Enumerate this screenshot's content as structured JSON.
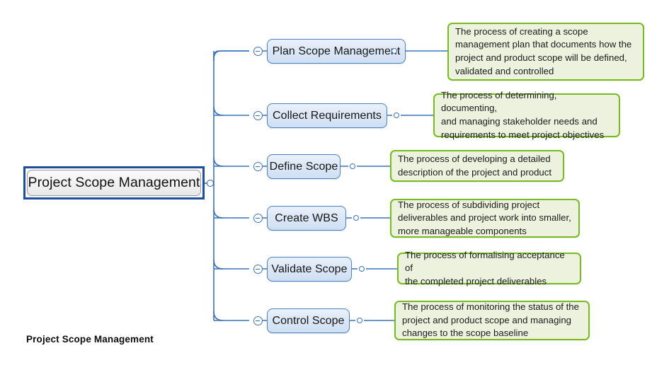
{
  "diagram": {
    "title": "Project Scope Management",
    "caption": "Project Scope Management",
    "colors": {
      "root_border": "#1F4E9C",
      "branch_border": "#4A82C4",
      "branch_fill": "#DBE7F6",
      "desc_border": "#76BC21",
      "desc_fill": "#EDF2DF",
      "connector": "#3C72B9",
      "background": "#FFFFFF"
    },
    "root": {
      "label": "Project Scope Management"
    },
    "branches": [
      {
        "label": "Plan Scope Management",
        "toggle_icon": "minus-circle-icon",
        "description": "The process of creating a scope\nmanagement plan that documents how the\nproject and product scope will be defined,\nvalidated and controlled"
      },
      {
        "label": "Collect Requirements",
        "toggle_icon": "minus-circle-icon",
        "description": "The process of determining, documenting,\nand managing stakeholder needs and\nrequirements to meet project objectives"
      },
      {
        "label": "Define Scope",
        "toggle_icon": "minus-circle-icon",
        "description": "The process of developing a detailed\ndescription of the project and product"
      },
      {
        "label": "Create WBS",
        "toggle_icon": "minus-circle-icon",
        "description": "The process of subdividing project\ndeliverables and project work into smaller,\nmore manageable components"
      },
      {
        "label": "Validate Scope",
        "toggle_icon": "minus-circle-icon",
        "description": "The process of formalising acceptance of\nthe completed project deliverables"
      },
      {
        "label": "Control Scope",
        "toggle_icon": "minus-circle-icon",
        "description": "The process of monitoring the status of the\nproject and product scope and managing\nchanges to the scope baseline"
      }
    ]
  }
}
